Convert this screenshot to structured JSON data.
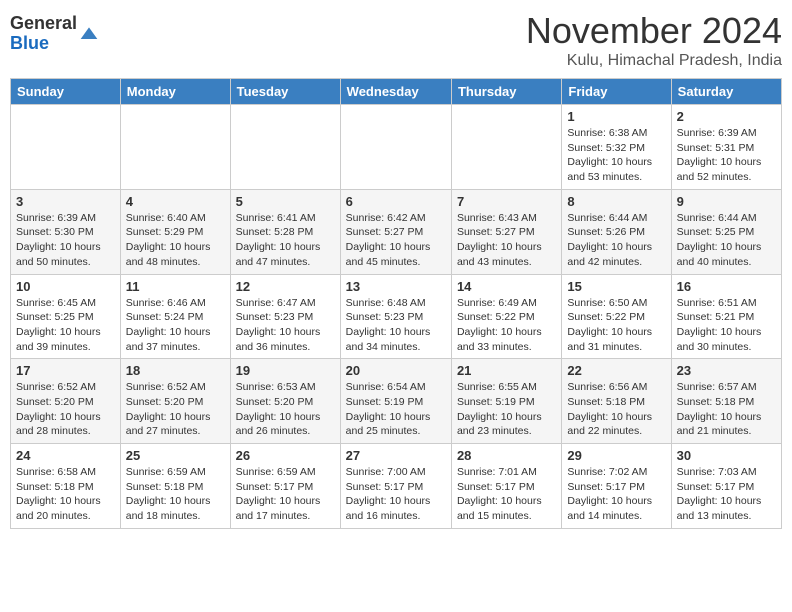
{
  "header": {
    "logo_general": "General",
    "logo_blue": "Blue",
    "month_title": "November 2024",
    "location": "Kulu, Himachal Pradesh, India"
  },
  "weekdays": [
    "Sunday",
    "Monday",
    "Tuesday",
    "Wednesday",
    "Thursday",
    "Friday",
    "Saturday"
  ],
  "weeks": [
    [
      {
        "day": "",
        "info": ""
      },
      {
        "day": "",
        "info": ""
      },
      {
        "day": "",
        "info": ""
      },
      {
        "day": "",
        "info": ""
      },
      {
        "day": "",
        "info": ""
      },
      {
        "day": "1",
        "info": "Sunrise: 6:38 AM\nSunset: 5:32 PM\nDaylight: 10 hours and 53 minutes."
      },
      {
        "day": "2",
        "info": "Sunrise: 6:39 AM\nSunset: 5:31 PM\nDaylight: 10 hours and 52 minutes."
      }
    ],
    [
      {
        "day": "3",
        "info": "Sunrise: 6:39 AM\nSunset: 5:30 PM\nDaylight: 10 hours and 50 minutes."
      },
      {
        "day": "4",
        "info": "Sunrise: 6:40 AM\nSunset: 5:29 PM\nDaylight: 10 hours and 48 minutes."
      },
      {
        "day": "5",
        "info": "Sunrise: 6:41 AM\nSunset: 5:28 PM\nDaylight: 10 hours and 47 minutes."
      },
      {
        "day": "6",
        "info": "Sunrise: 6:42 AM\nSunset: 5:27 PM\nDaylight: 10 hours and 45 minutes."
      },
      {
        "day": "7",
        "info": "Sunrise: 6:43 AM\nSunset: 5:27 PM\nDaylight: 10 hours and 43 minutes."
      },
      {
        "day": "8",
        "info": "Sunrise: 6:44 AM\nSunset: 5:26 PM\nDaylight: 10 hours and 42 minutes."
      },
      {
        "day": "9",
        "info": "Sunrise: 6:44 AM\nSunset: 5:25 PM\nDaylight: 10 hours and 40 minutes."
      }
    ],
    [
      {
        "day": "10",
        "info": "Sunrise: 6:45 AM\nSunset: 5:25 PM\nDaylight: 10 hours and 39 minutes."
      },
      {
        "day": "11",
        "info": "Sunrise: 6:46 AM\nSunset: 5:24 PM\nDaylight: 10 hours and 37 minutes."
      },
      {
        "day": "12",
        "info": "Sunrise: 6:47 AM\nSunset: 5:23 PM\nDaylight: 10 hours and 36 minutes."
      },
      {
        "day": "13",
        "info": "Sunrise: 6:48 AM\nSunset: 5:23 PM\nDaylight: 10 hours and 34 minutes."
      },
      {
        "day": "14",
        "info": "Sunrise: 6:49 AM\nSunset: 5:22 PM\nDaylight: 10 hours and 33 minutes."
      },
      {
        "day": "15",
        "info": "Sunrise: 6:50 AM\nSunset: 5:22 PM\nDaylight: 10 hours and 31 minutes."
      },
      {
        "day": "16",
        "info": "Sunrise: 6:51 AM\nSunset: 5:21 PM\nDaylight: 10 hours and 30 minutes."
      }
    ],
    [
      {
        "day": "17",
        "info": "Sunrise: 6:52 AM\nSunset: 5:20 PM\nDaylight: 10 hours and 28 minutes."
      },
      {
        "day": "18",
        "info": "Sunrise: 6:52 AM\nSunset: 5:20 PM\nDaylight: 10 hours and 27 minutes."
      },
      {
        "day": "19",
        "info": "Sunrise: 6:53 AM\nSunset: 5:20 PM\nDaylight: 10 hours and 26 minutes."
      },
      {
        "day": "20",
        "info": "Sunrise: 6:54 AM\nSunset: 5:19 PM\nDaylight: 10 hours and 25 minutes."
      },
      {
        "day": "21",
        "info": "Sunrise: 6:55 AM\nSunset: 5:19 PM\nDaylight: 10 hours and 23 minutes."
      },
      {
        "day": "22",
        "info": "Sunrise: 6:56 AM\nSunset: 5:18 PM\nDaylight: 10 hours and 22 minutes."
      },
      {
        "day": "23",
        "info": "Sunrise: 6:57 AM\nSunset: 5:18 PM\nDaylight: 10 hours and 21 minutes."
      }
    ],
    [
      {
        "day": "24",
        "info": "Sunrise: 6:58 AM\nSunset: 5:18 PM\nDaylight: 10 hours and 20 minutes."
      },
      {
        "day": "25",
        "info": "Sunrise: 6:59 AM\nSunset: 5:18 PM\nDaylight: 10 hours and 18 minutes."
      },
      {
        "day": "26",
        "info": "Sunrise: 6:59 AM\nSunset: 5:17 PM\nDaylight: 10 hours and 17 minutes."
      },
      {
        "day": "27",
        "info": "Sunrise: 7:00 AM\nSunset: 5:17 PM\nDaylight: 10 hours and 16 minutes."
      },
      {
        "day": "28",
        "info": "Sunrise: 7:01 AM\nSunset: 5:17 PM\nDaylight: 10 hours and 15 minutes."
      },
      {
        "day": "29",
        "info": "Sunrise: 7:02 AM\nSunset: 5:17 PM\nDaylight: 10 hours and 14 minutes."
      },
      {
        "day": "30",
        "info": "Sunrise: 7:03 AM\nSunset: 5:17 PM\nDaylight: 10 hours and 13 minutes."
      }
    ]
  ]
}
